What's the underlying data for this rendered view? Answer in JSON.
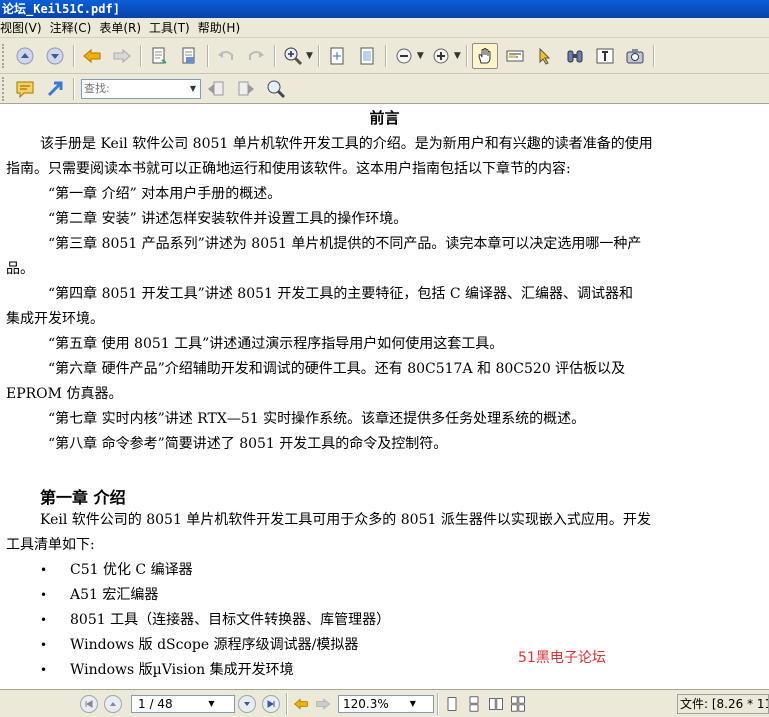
{
  "window": {
    "title": "论坛_Keil51C.pdf]"
  },
  "menu": [
    "视图(V)",
    "注释(C)",
    "表单(R)",
    "工具(T)",
    "帮助(H)"
  ],
  "search": {
    "placeholder": "查找:"
  },
  "document": {
    "heading": "前言",
    "intro_lines": [
      "该手册是 Keil 软件公司 8051 单片机软件开发工具的介绍。是为新用户和有兴趣的读者准备的使用",
      "指南。只需要阅读本书就可以正确地运行和使用该软件。这本用户指南包括以下章节的内容:"
    ],
    "chapters": [
      {
        "lines": [
          "“第一章    介绍”  对本用户手册的概述。"
        ]
      },
      {
        "lines": [
          "“第二章    安装”  讲述怎样安装软件并设置工具的操作环境。"
        ]
      },
      {
        "lines": [
          "“第三章    8051 产品系列”讲述为 8051 单片机提供的不同产品。读完本章可以决定选用哪一种产",
          "品。"
        ]
      },
      {
        "lines": [
          "“第四章    8051 开发工具”讲述 8051 开发工具的主要特征，包括 C 编译器、汇编器、调试器和",
          "集成开发环境。"
        ]
      },
      {
        "lines": [
          "“第五章    使用 8051 工具”讲述通过演示程序指导用户如何使用这套工具。"
        ]
      },
      {
        "lines": [
          "“第六章    硬件产品”介绍辅助开发和调试的硬件工具。还有 80C517A 和 80C520 评估板以及",
          "EPROM 仿真器。"
        ]
      },
      {
        "lines": [
          "“第七章    实时内核”讲述 RTX—51 实时操作系统。该章还提供多任务处理系统的概述。"
        ]
      },
      {
        "lines": [
          "“第八章    命令参考”简要讲述了 8051 开发工具的命令及控制符。"
        ]
      }
    ],
    "chapter1": {
      "title": "第一章    介绍",
      "intro_lines": [
        "Keil 软件公司的 8051 单片机软件开发工具可用于众多的 8051 派生器件以实现嵌入式应用。开发",
        "工具清单如下:"
      ],
      "bullets": [
        "C51 优化 C 编译器",
        "A51 宏汇编器",
        "8051 工具（连接器、目标文件转换器、库管理器）",
        "Windows 版 dScope 源程序级调试器/模拟器",
        "Windows 版µVision 集成开发环境"
      ]
    },
    "watermark": "51黑电子论坛"
  },
  "status": {
    "page": "1 / 48",
    "zoom": "120.3%",
    "file_info": "文件: [8.26 * 11"
  }
}
